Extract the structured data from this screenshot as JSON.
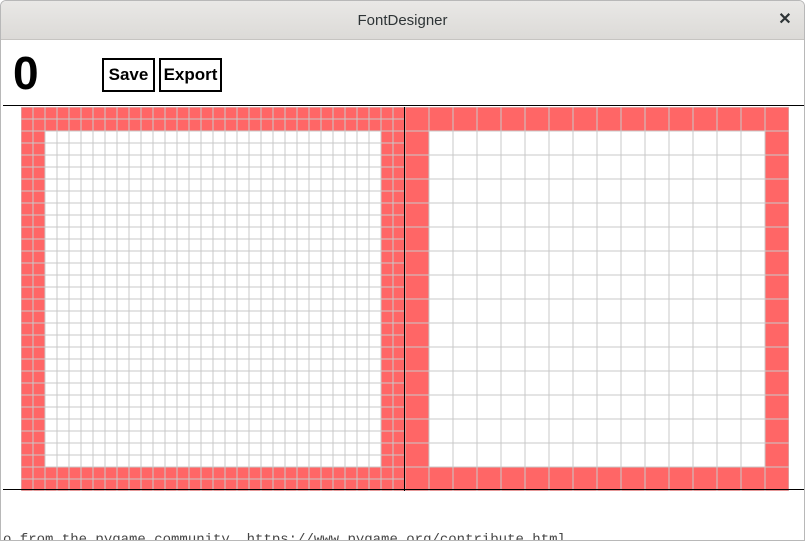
{
  "window": {
    "title": "FontDesigner"
  },
  "toolbar": {
    "counter": "0",
    "save_label": "Save",
    "export_label": "Export"
  },
  "editor": {
    "grid_cells": 32,
    "preview_cells": 16,
    "colors": {
      "border": "#ff6666",
      "grid_line": "#c8c8c8",
      "cell": "#ffffff"
    }
  },
  "status": {
    "text": "o from the pygame community. https://www.pygame.org/contribute.html"
  },
  "icons": {
    "close": "close-icon"
  }
}
